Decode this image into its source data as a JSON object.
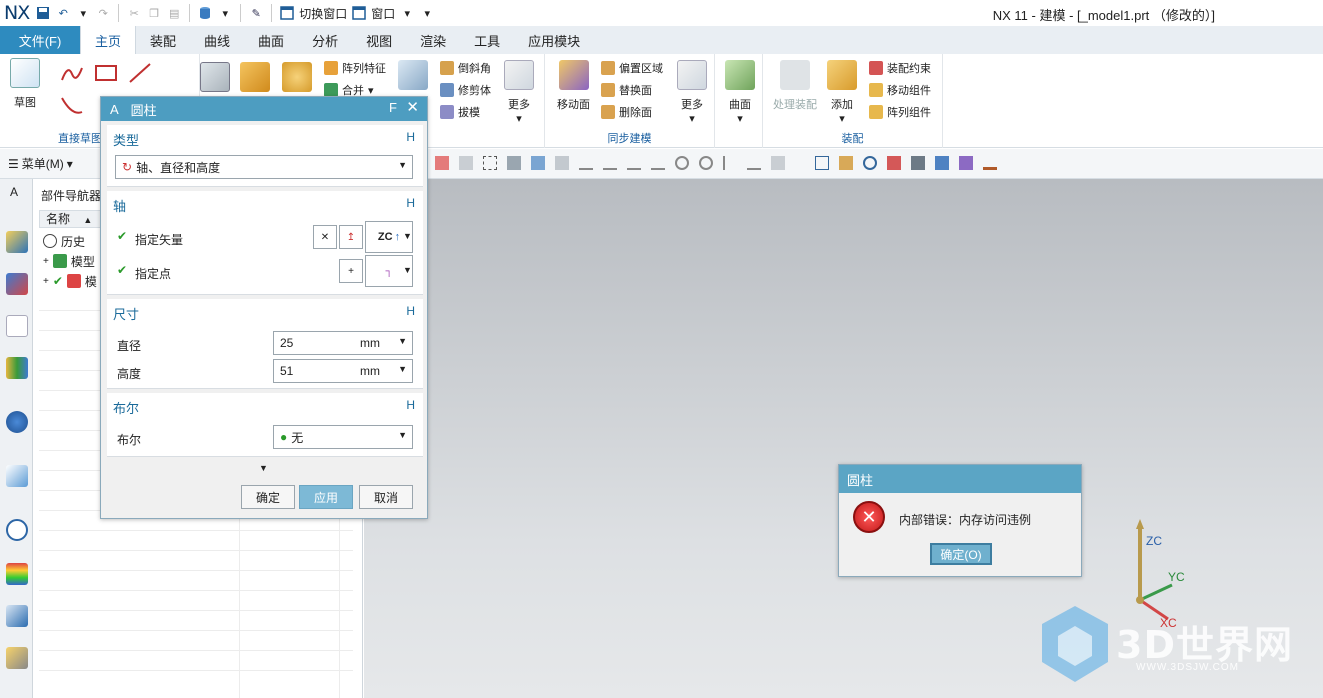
{
  "app": {
    "logo": "NX",
    "window_title": "NX 11 - 建模 - [_model1.prt （修改的）]"
  },
  "quick_access": {
    "switch_window": "切换窗口",
    "window": "窗口"
  },
  "tabs": [
    {
      "label": "文件(F)"
    },
    {
      "label": "主页"
    },
    {
      "label": "装配"
    },
    {
      "label": "曲线"
    },
    {
      "label": "曲面"
    },
    {
      "label": "分析"
    },
    {
      "label": "视图"
    },
    {
      "label": "渲染"
    },
    {
      "label": "工具"
    },
    {
      "label": "应用模块"
    }
  ],
  "ribbon": {
    "sketch": "草图",
    "direct_sketch_group": "直接草图",
    "pattern_feature": "阵列特征",
    "combine": "合并",
    "chamfer": "倒斜角",
    "trim_body": "修剪体",
    "draft": "拔模",
    "more1": "更多",
    "move_face": "移动面",
    "offset_region": "偏置区域",
    "replace_face": "替换面",
    "delete_face": "删除面",
    "more2": "更多",
    "sync_group": "同步建模",
    "surface": "曲面",
    "process_assembly": "处理装配",
    "add": "添加",
    "assembly_constraint": "装配约束",
    "move_component": "移动组件",
    "pattern_component": "阵列组件",
    "assembly_group": "装配"
  },
  "toolbar": {
    "menu": "菜单(M)"
  },
  "navigator": {
    "title": "部件导航器",
    "column_name": "名称",
    "rows": [
      "历史",
      "模型",
      "模"
    ]
  },
  "cylinder_dialog": {
    "title": "圆柱",
    "type_header": "类型",
    "type_value": "轴、直径和高度",
    "axis_header": "轴",
    "specify_vector": "指定矢量",
    "vector_value": "ZC",
    "specify_point": "指定点",
    "dimensions_header": "尺寸",
    "diameter_label": "直径",
    "diameter_value": "25",
    "diameter_unit": "mm",
    "height_label": "高度",
    "height_value": "51",
    "height_unit": "mm",
    "boolean_header": "布尔",
    "boolean_label": "布尔",
    "boolean_value": "无",
    "hide_key": "H",
    "ok": "确定",
    "apply": "应用",
    "cancel": "取消"
  },
  "error_dialog": {
    "title": "圆柱",
    "message": "内部错误：内存访问违例",
    "ok": "确定(O)"
  },
  "triad": {
    "z": "ZC",
    "y": "YC",
    "x": "XC"
  },
  "watermark": {
    "brand": "3D世界网",
    "url": "WWW.3DSJW.COM"
  },
  "colors": {
    "accent": "#2e8bbf",
    "dialog_title": "#4d9dc1",
    "error_red": "#c21818"
  }
}
